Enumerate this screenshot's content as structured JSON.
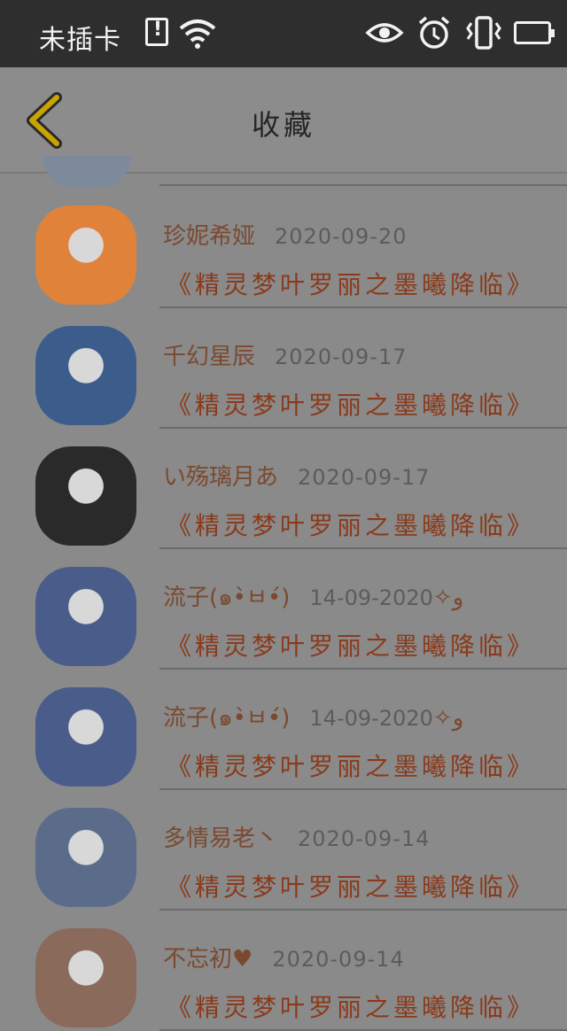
{
  "status": {
    "carrier": "未插卡",
    "icons": [
      "sim-alert-icon",
      "wifi-icon",
      "eye-icon",
      "alarm-icon",
      "vibrate-icon",
      "battery-charging-icon"
    ]
  },
  "header": {
    "title": "收藏",
    "back_icon": "chevron-left-icon",
    "accent": "#c9a400"
  },
  "favorites": [
    {
      "name": "珍妮希娅",
      "date": "2020-09-20",
      "book": "《精灵梦叶罗丽之墨曦降临》",
      "avatar_color": "#e0823a"
    },
    {
      "name": "千幻星辰",
      "date": "2020-09-17",
      "book": "《精灵梦叶罗丽之墨曦降临》",
      "avatar_color": "#3c5c8c"
    },
    {
      "name": "い殇璃月あ",
      "date": "2020-09-17",
      "book": "《精灵梦叶罗丽之墨曦降临》",
      "avatar_color": "#2a2a2a"
    },
    {
      "name": "流子(๑•̀ㅂ•́)و✧",
      "date": "2020-09-14",
      "book": "《精灵梦叶罗丽之墨曦降临》",
      "avatar_color": "#4a5c8a"
    },
    {
      "name": "流子(๑•̀ㅂ•́)و✧",
      "date": "2020-09-14",
      "book": "《精灵梦叶罗丽之墨曦降临》",
      "avatar_color": "#4a5c8a"
    },
    {
      "name": "多情易老丶",
      "date": "2020-09-14",
      "book": "《精灵梦叶罗丽之墨曦降临》",
      "avatar_color": "#5a6c8a"
    },
    {
      "name": "不忘初♥",
      "date": "2020-09-14",
      "book": "《精灵梦叶罗丽之墨曦降临》",
      "avatar_color": "#8a6a5a"
    }
  ]
}
